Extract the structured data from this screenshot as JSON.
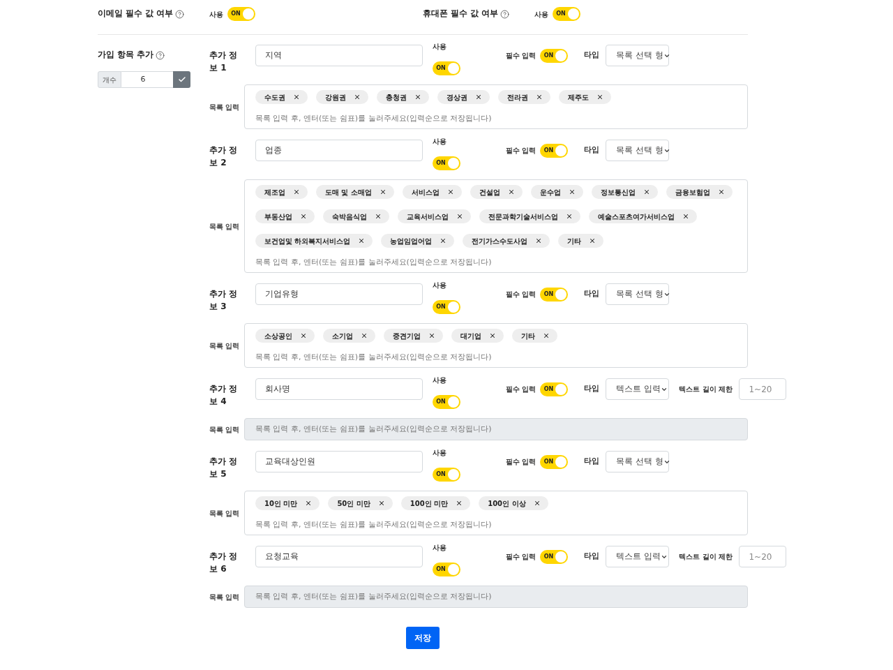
{
  "settings": [
    {
      "label": "이메일 필수 값 여부",
      "toggle_label": "사용",
      "toggle": {
        "on": true,
        "text": "ON"
      }
    },
    {
      "label": "휴대폰 필수 값 여부",
      "toggle_label": "사용",
      "toggle": {
        "on": true,
        "text": "ON"
      }
    }
  ],
  "signup_fields": {
    "label": "가입 항목 추가",
    "count": {
      "addon": "개수",
      "value": "6"
    },
    "items": [
      {
        "label": "추가 정보 1",
        "name": "지역",
        "use": {
          "label": "사용",
          "on": true,
          "text": "ON"
        },
        "required": {
          "label": "필수 입력",
          "on": true,
          "text": "ON"
        },
        "type": {
          "label": "타입",
          "value": "목록 선택 형"
        },
        "list": {
          "label": "목록 입력",
          "disabled": false,
          "tags": [
            "수도권",
            "강원권",
            "충청권",
            "경상권",
            "전라권",
            "제주도"
          ],
          "placeholder": "목록 입력 후, 엔터(또는 쉼표)를 눌러주세요(입력순으로 저장됩니다)"
        }
      },
      {
        "label": "추가 정보 2",
        "name": "업종",
        "use": {
          "label": "사용",
          "on": true,
          "text": "ON"
        },
        "required": {
          "label": "필수 입력",
          "on": true,
          "text": "ON"
        },
        "type": {
          "label": "타입",
          "value": "목록 선택 형"
        },
        "list": {
          "label": "목록 입력",
          "disabled": false,
          "tags": [
            "제조업",
            "도매 및 소매업",
            "서비스업",
            "건설업",
            "운수업",
            "정보통신업",
            "금융보험업",
            "부동산업",
            "숙박음식업",
            "교육서비스업",
            "전문과학기술서비스업",
            "예술스포츠여가서비스업",
            "보건업및 하외복지서비스업",
            "농업임업어업",
            "전기가스수도사업",
            "기타"
          ],
          "placeholder": "목록 입력 후, 엔터(또는 쉼표)를 눌러주세요(입력순으로 저장됩니다)"
        }
      },
      {
        "label": "추가 정보 3",
        "name": "기업유형",
        "use": {
          "label": "사용",
          "on": true,
          "text": "ON"
        },
        "required": {
          "label": "필수 입력",
          "on": true,
          "text": "ON"
        },
        "type": {
          "label": "타입",
          "value": "목록 선택 형"
        },
        "list": {
          "label": "목록 입력",
          "disabled": false,
          "tags": [
            "소상공인",
            "소기업",
            "중견기업",
            "대기업",
            "기타"
          ],
          "placeholder": "목록 입력 후, 엔터(또는 쉼표)를 눌러주세요(입력순으로 저장됩니다)"
        }
      },
      {
        "label": "추가 정보 4",
        "name": "회사명",
        "use": {
          "label": "사용",
          "on": true,
          "text": "ON"
        },
        "required": {
          "label": "필수 입력",
          "on": true,
          "text": "ON"
        },
        "type": {
          "label": "타입",
          "value": "텍스트 입력"
        },
        "length_limit": {
          "label": "텍스트 길이 제한",
          "placeholder": "1~20"
        },
        "list": {
          "label": "목록 입력",
          "disabled": true,
          "placeholder": "목록 입력 후, 엔터(또는 쉼표)를 눌러주세요(입력순으로 저장됩니다)"
        }
      },
      {
        "label": "추가 정보 5",
        "name": "교육대상인원",
        "use": {
          "label": "사용",
          "on": true,
          "text": "ON"
        },
        "required": {
          "label": "필수 입력",
          "on": true,
          "text": "ON"
        },
        "type": {
          "label": "타입",
          "value": "목록 선택 형"
        },
        "list": {
          "label": "목록 입력",
          "disabled": false,
          "tags": [
            "10인 미만",
            "50인 미만",
            "100인 미만",
            "100인 이상"
          ],
          "placeholder": "목록 입력 후, 엔터(또는 쉼표)를 눌러주세요(입력순으로 저장됩니다)"
        }
      },
      {
        "label": "추가 정보 6",
        "name": "요청교육",
        "use": {
          "label": "사용",
          "on": true,
          "text": "ON"
        },
        "required": {
          "label": "필수 입력",
          "on": true,
          "text": "ON"
        },
        "type": {
          "label": "타입",
          "value": "텍스트 입력"
        },
        "length_limit": {
          "label": "텍스트 길이 제한",
          "placeholder": "1~20"
        },
        "list": {
          "label": "목록 입력",
          "disabled": true,
          "placeholder": "목록 입력 후, 엔터(또는 쉼표)를 눌러주세요(입력순으로 저장됩니다)"
        }
      }
    ]
  },
  "save_button": "저장"
}
